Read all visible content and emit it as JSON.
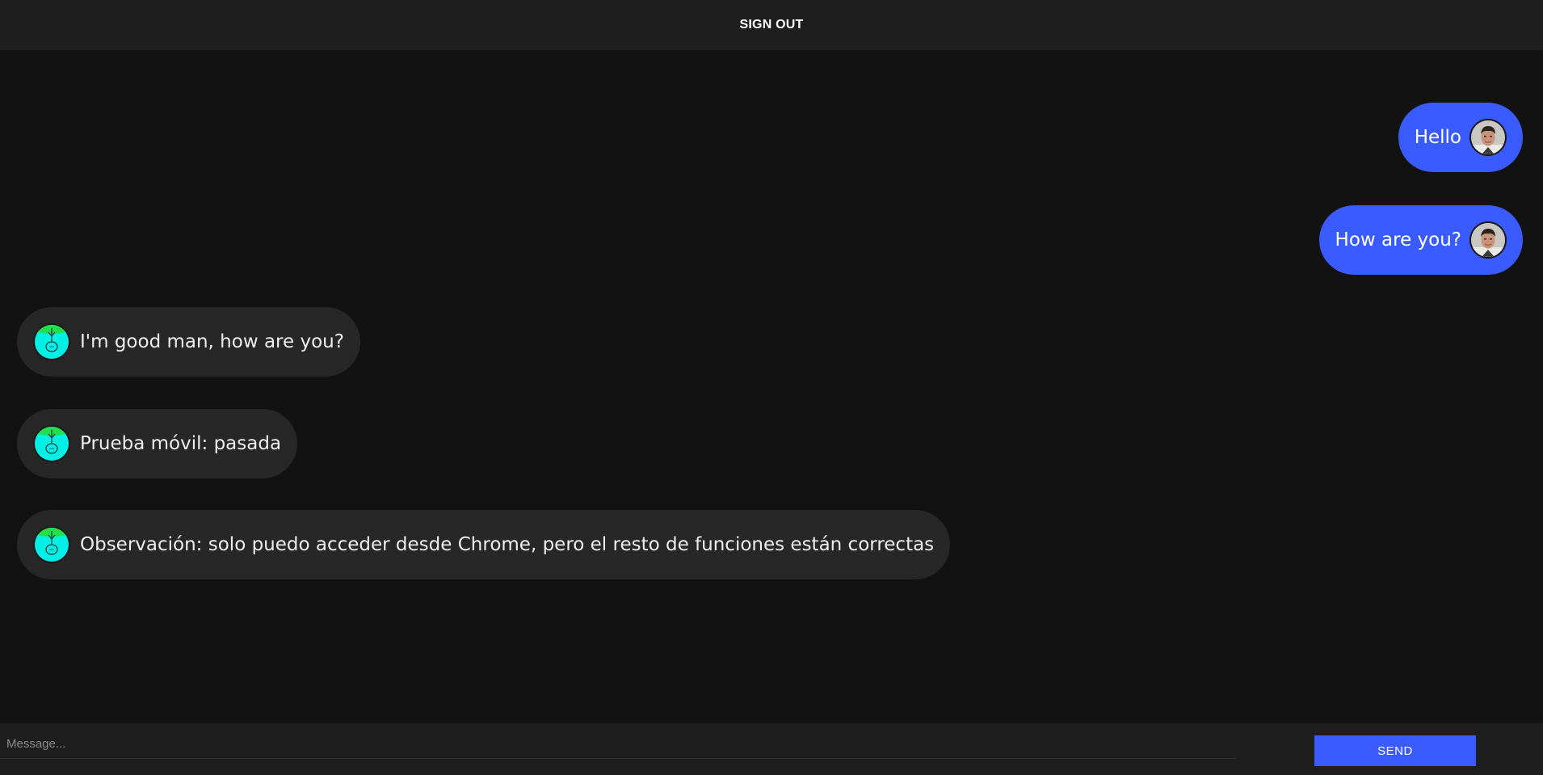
{
  "header": {
    "signout_label": "SIGN OUT"
  },
  "messages": [
    {
      "direction": "sent",
      "text": "Hello",
      "avatar": "user-photo-avatar"
    },
    {
      "direction": "sent",
      "text": "How are you?",
      "avatar": "user-photo-avatar"
    },
    {
      "direction": "received",
      "text": "I'm good man, how are you?",
      "avatar": "cyan-stick-figure-avatar"
    },
    {
      "direction": "received",
      "text": "Prueba móvil: pasada",
      "avatar": "cyan-stick-figure-avatar"
    },
    {
      "direction": "received",
      "text": "Observación: solo puedo acceder desde Chrome, pero el resto de funciones están correctas",
      "avatar": "cyan-stick-figure-avatar"
    }
  ],
  "composer": {
    "placeholder": "Message...",
    "value": "",
    "send_label": "SEND"
  },
  "colors": {
    "background": "#121212",
    "bar": "#1e1e1e",
    "sent_bubble": "#3a5bff",
    "received_bubble": "#272727",
    "avatar_bot": "#00f0e6"
  }
}
